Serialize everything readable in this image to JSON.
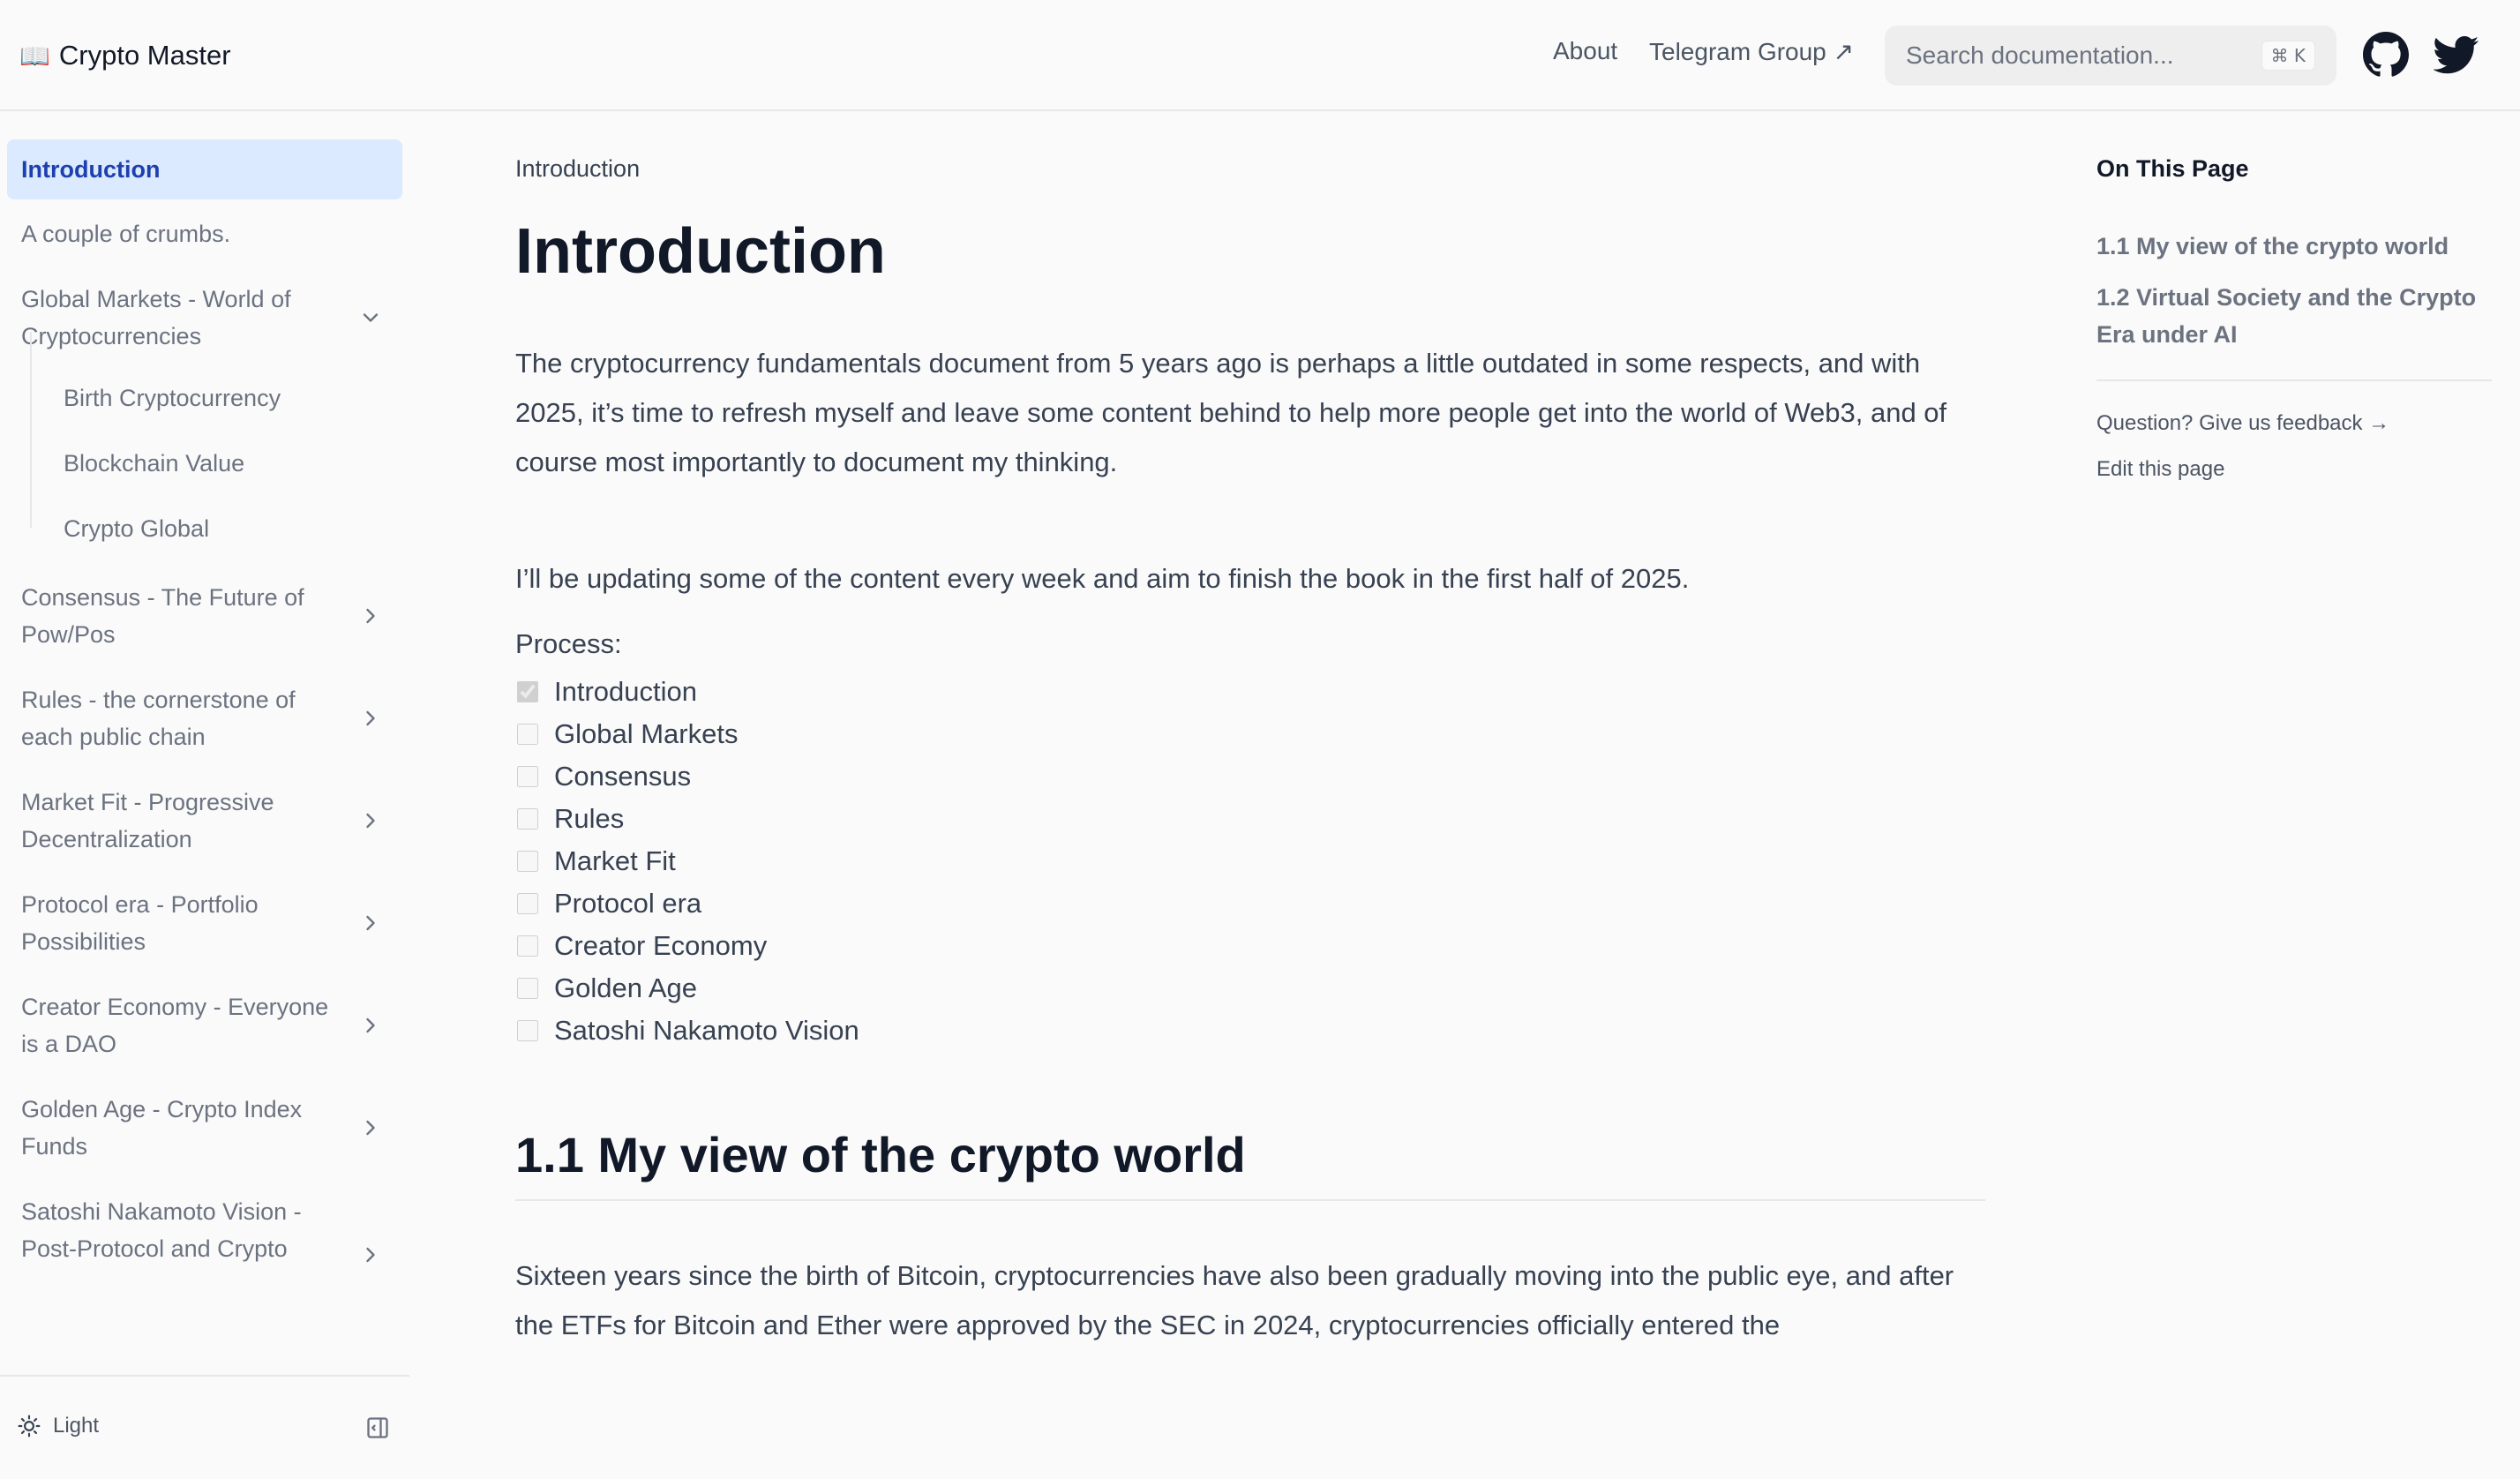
{
  "navbar": {
    "logo_icon": "📖",
    "logo_text": "Crypto Master",
    "about": "About",
    "telegram": "Telegram Group ↗",
    "search_placeholder": "Search documentation...",
    "search_kbd": "⌘ K",
    "github_icon": "github-icon",
    "twitter_icon": "twitter-icon"
  },
  "sidebar": {
    "items": [
      {
        "label": "Introduction",
        "active": true
      },
      {
        "label": "A couple of crumbs."
      },
      {
        "label": "Global Markets - World of Cryptocurrencies",
        "chevron": "down"
      },
      {
        "label": "Consensus - The Future of Pow/Pos",
        "chevron": "right"
      },
      {
        "label": "Rules - the cornerstone of each public chain",
        "chevron": "right"
      },
      {
        "label": "Market Fit - Progressive Decentralization",
        "chevron": "right"
      },
      {
        "label": "Protocol era - Portfolio Possibilities",
        "chevron": "right"
      },
      {
        "label": "Creator Economy - Everyone is a DAO",
        "chevron": "right"
      },
      {
        "label": "Golden Age - Crypto Index Funds",
        "chevron": "right"
      },
      {
        "label": "Satoshi Nakamoto Vision - Post-Protocol and Crypto",
        "chevron": "right"
      }
    ],
    "subitems": [
      "Birth Cryptocurrency",
      "Blockchain Value",
      "Crypto Global"
    ],
    "theme_label": "Light"
  },
  "main": {
    "breadcrumb": "Introduction",
    "title": "Introduction",
    "para1": "The cryptocurrency fundamentals document from 5 years ago is perhaps a little outdated in some respects, and with 2025, it’s time to refresh myself and leave some content behind to help more people get into the world of Web3, and of course most importantly to document my thinking.",
    "para2": "I’ll be updating some of the content every week and aim to finish the book in the first half of 2025.",
    "process_label": "Process:",
    "tasks": [
      {
        "label": "Introduction",
        "checked": true
      },
      {
        "label": "Global Markets",
        "checked": false
      },
      {
        "label": "Consensus",
        "checked": false
      },
      {
        "label": "Rules",
        "checked": false
      },
      {
        "label": "Market Fit",
        "checked": false
      },
      {
        "label": "Protocol era",
        "checked": false
      },
      {
        "label": "Creator Economy",
        "checked": false
      },
      {
        "label": "Golden Age",
        "checked": false
      },
      {
        "label": "Satoshi Nakamoto Vision",
        "checked": false
      }
    ],
    "h2": "1.1 My view of the crypto world",
    "para3": "Sixteen years since the birth of Bitcoin, cryptocurrencies have also been gradually moving into the public eye, and after the ETFs for Bitcoin and Ether were approved by the SEC in 2024, cryptocurrencies officially entered the"
  },
  "toc": {
    "title": "On This Page",
    "links": [
      "1.1 My view of the crypto world",
      "1.2 Virtual Society and the Crypto Era under AI"
    ],
    "feedback": "Question? Give us feedback →",
    "edit": "Edit this page"
  },
  "colors": {
    "accent": "#1e40af",
    "active_bg": "#dbeafe",
    "background": "#fafafa",
    "text": "#374151",
    "muted": "#6b7280"
  }
}
